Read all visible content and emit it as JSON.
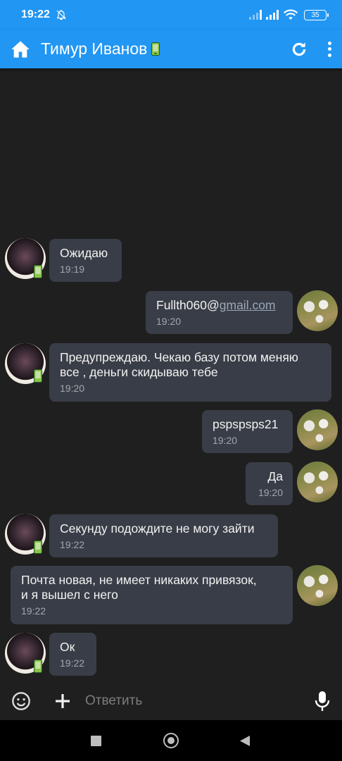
{
  "status_bar": {
    "time": "19:22",
    "battery": "35",
    "icons": [
      "bell-off-icon",
      "signal-icon",
      "signal-icon",
      "wifi-icon",
      "battery-icon"
    ]
  },
  "header": {
    "title": "Тимур Иванов",
    "icons": [
      "home-icon",
      "mobile-badge-icon",
      "refresh-icon",
      "more-vert-icon"
    ],
    "accent": "#2196f3"
  },
  "messages": [
    {
      "from": "them",
      "text": "Ожидаю",
      "time": "19:19"
    },
    {
      "from": "me",
      "text": "Fullth060@",
      "link": "gmail.com",
      "time": "19:20"
    },
    {
      "from": "them",
      "text": "Предупреждаю. Чекаю базу потом меняю\nвсе , деньги скидываю тебе",
      "time": "19:20"
    },
    {
      "from": "me",
      "text": "pspspsps21",
      "time": "19:20"
    },
    {
      "from": "me",
      "text": "Да",
      "time": "19:20"
    },
    {
      "from": "them",
      "text": "Секунду подождите не могу зайти",
      "time": "19:22"
    },
    {
      "from": "me",
      "text": "Почта новая, не имеет никаких привязок,\nи я вышел с него",
      "time": "19:22"
    },
    {
      "from": "them",
      "text": "Ок",
      "time": "19:22"
    }
  ],
  "input": {
    "placeholder": "Ответить",
    "icons": [
      "emoji-icon",
      "add-icon",
      "mic-icon"
    ]
  },
  "nav": {
    "icons": [
      "recents-icon",
      "home-nav-icon",
      "back-icon"
    ]
  },
  "colors": {
    "background": "#1f1f1f",
    "bubble": "#393d47",
    "time_text": "#a3a6ad"
  }
}
